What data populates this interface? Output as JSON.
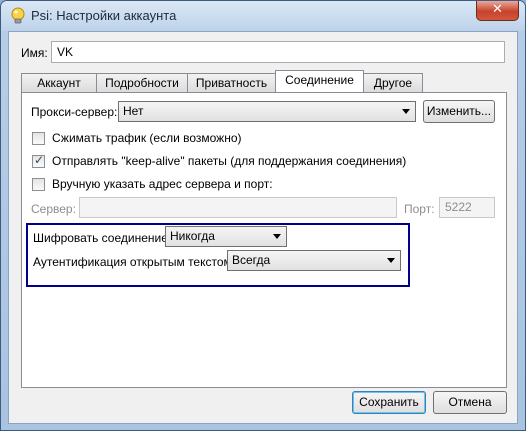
{
  "window": {
    "title": "Psi: Настройки аккаунта",
    "close_glyph": "✕"
  },
  "name": {
    "label": "Имя:",
    "value": "VK"
  },
  "tabs": [
    {
      "label": "Аккаунт"
    },
    {
      "label": "Подробности"
    },
    {
      "label": "Приватность"
    },
    {
      "label": "Соединение",
      "active": true
    },
    {
      "label": "Другое"
    }
  ],
  "connection": {
    "proxy_label": "Прокси-сервер:",
    "proxy_value": "Нет",
    "proxy_edit_button": "Изменить...",
    "compress_label": "Сжимать трафик (если возможно)",
    "compress_checked": false,
    "keepalive_label": "Отправлять \"keep-alive\" пакеты (для поддержания соединения)",
    "keepalive_checked": true,
    "manual_host_label": "Вручную указать адрес сервера и порт:",
    "manual_host_checked": false,
    "server_label": "Сервер:",
    "server_value": "",
    "port_label": "Порт:",
    "port_value": "5222",
    "encrypt_label": "Шифровать соединение:",
    "encrypt_value": "Никогда",
    "plaintext_auth_label": "Аутентификация открытым текстом:",
    "plaintext_auth_value": "Всегда"
  },
  "footer": {
    "save_button": "Сохранить",
    "cancel_button": "Отмена"
  },
  "icons": {
    "app": "psi-lightbulb-icon",
    "check": "checkmark-icon",
    "dropdown": "chevron-down-icon"
  },
  "colors": {
    "title_bar": "#c9dcef",
    "close_button": "#c8432c",
    "highlight_border": "#00008b",
    "default_button_border": "#3c7fb1"
  }
}
